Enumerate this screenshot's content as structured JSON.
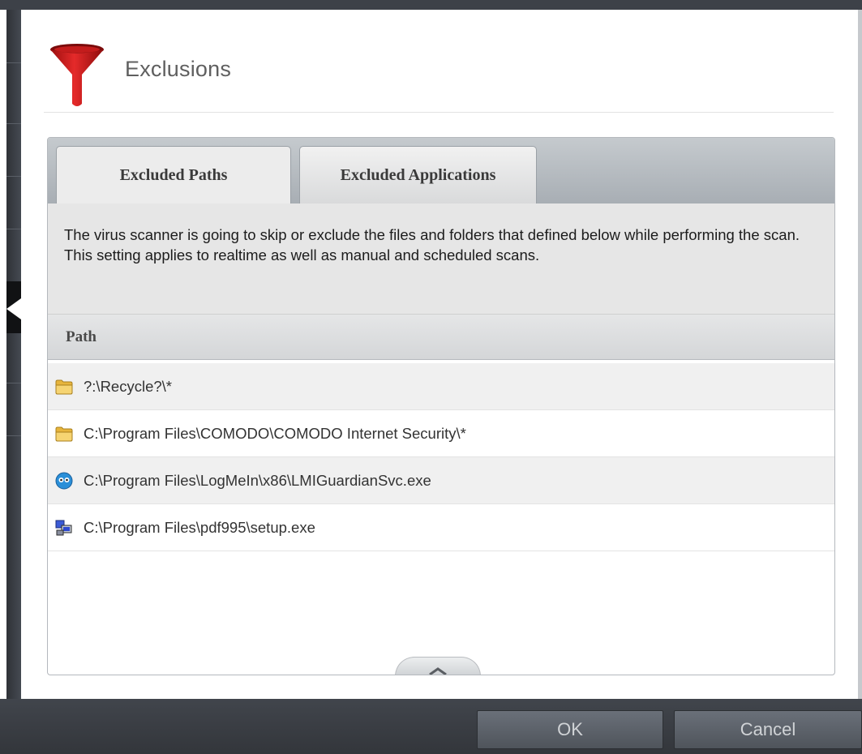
{
  "dialog": {
    "title": "Exclusions",
    "icon": "funnel-icon"
  },
  "tabs": [
    {
      "label": "Excluded Paths",
      "active": true
    },
    {
      "label": "Excluded Applications",
      "active": false
    }
  ],
  "description": "The virus scanner is going to skip or exclude the files and folders that defined below while performing the scan. This setting applies to realtime as well as manual and scheduled scans.",
  "table": {
    "column_header": "Path",
    "rows": [
      {
        "path": "?:\\Recycle?\\*",
        "icon": "folder-icon"
      },
      {
        "path": "C:\\Program Files\\COMODO\\COMODO Internet Security\\*",
        "icon": "folder-icon"
      },
      {
        "path": "C:\\Program Files\\LogMeIn\\x86\\LMIGuardianSvc.exe",
        "icon": "logmein-app-icon"
      },
      {
        "path": "C:\\Program Files\\pdf995\\setup.exe",
        "icon": "setup-app-icon"
      }
    ]
  },
  "buttons": {
    "ok": "OK",
    "cancel": "Cancel"
  },
  "colors": {
    "funnel": "#d81e1e",
    "folder": "#f2c64e",
    "frame": "#3d4148"
  }
}
